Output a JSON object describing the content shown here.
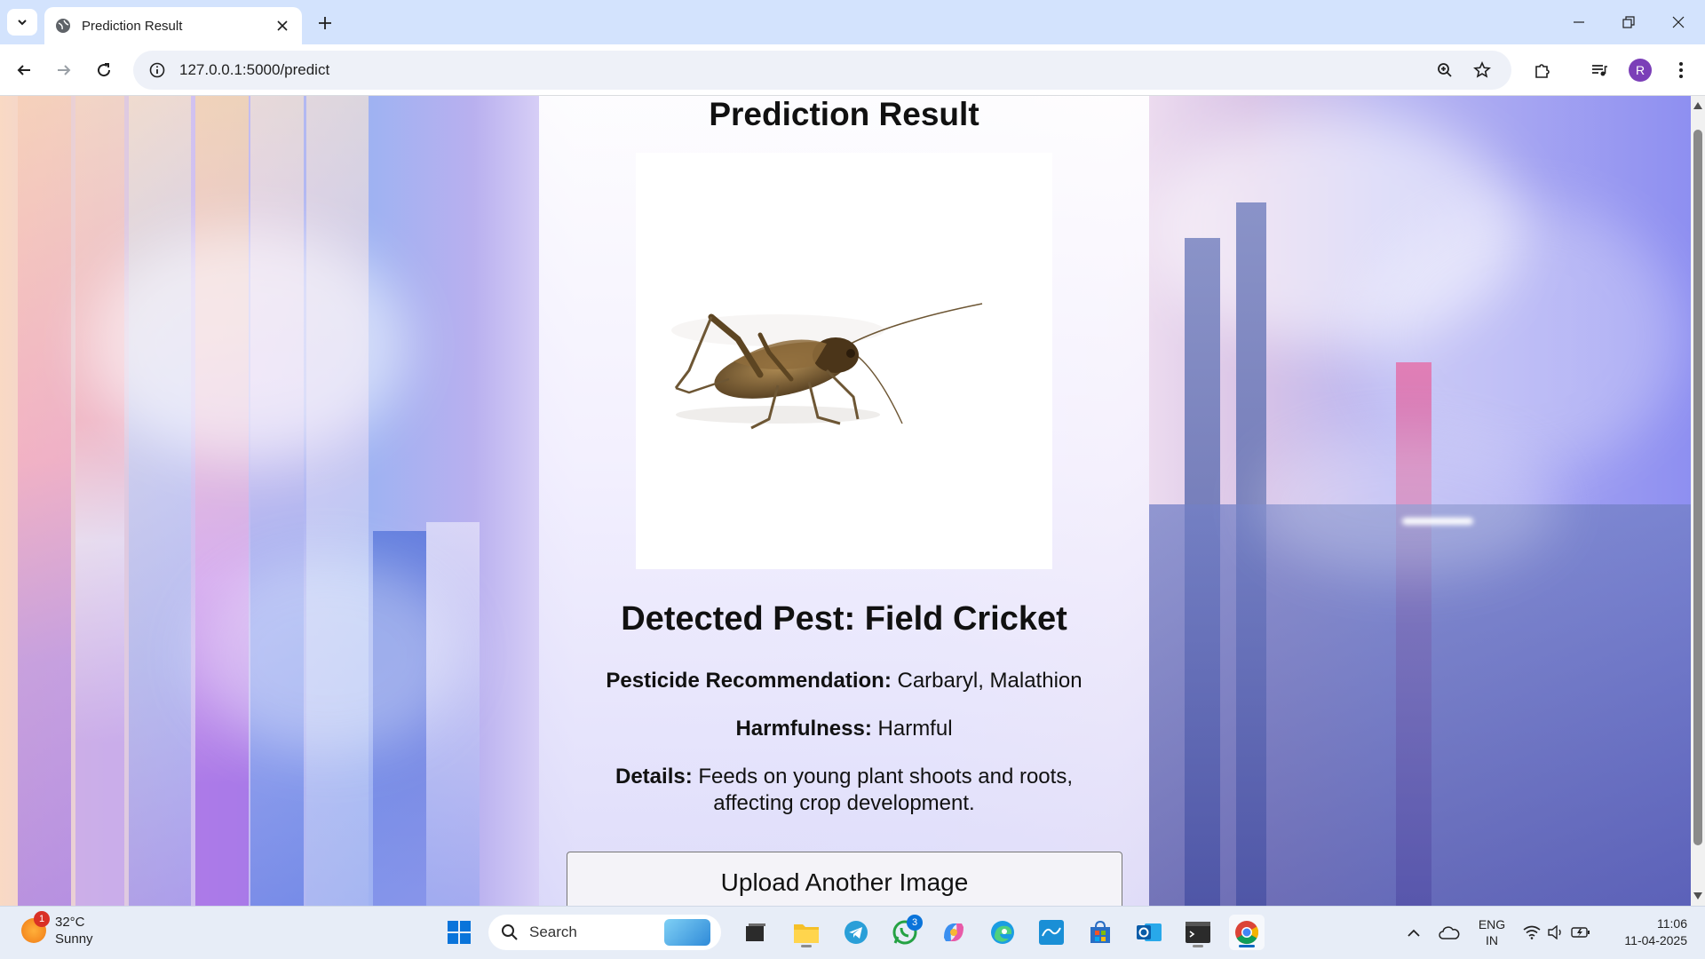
{
  "browser": {
    "tab_title": "Prediction Result",
    "url": "127.0.0.1:5000/predict",
    "profile_initial": "R"
  },
  "page": {
    "heading": "Prediction Result",
    "pest_image_alt": "field-cricket-photo",
    "detected_label": "Detected Pest: Field Cricket",
    "pesticide_label": "Pesticide Recommendation:",
    "pesticide_value": "Carbaryl, Malathion",
    "harmfulness_label": "Harmfulness:",
    "harmfulness_value": "Harmful",
    "details_label": "Details:",
    "details_value": "Feeds on young plant shoots and roots, affecting crop development.",
    "upload_button": "Upload Another Image"
  },
  "taskbar": {
    "weather_temp": "32°C",
    "weather_cond": "Sunny",
    "weather_badge": "1",
    "search_label": "Search",
    "whatsapp_badge": "3",
    "lang_top": "ENG",
    "lang_bottom": "IN",
    "time": "11:06",
    "date": "11-04-2025"
  },
  "colors": {
    "accent": "#0067c0",
    "tabstrip": "#d3e3fd",
    "avatar": "#7b3fb8"
  }
}
